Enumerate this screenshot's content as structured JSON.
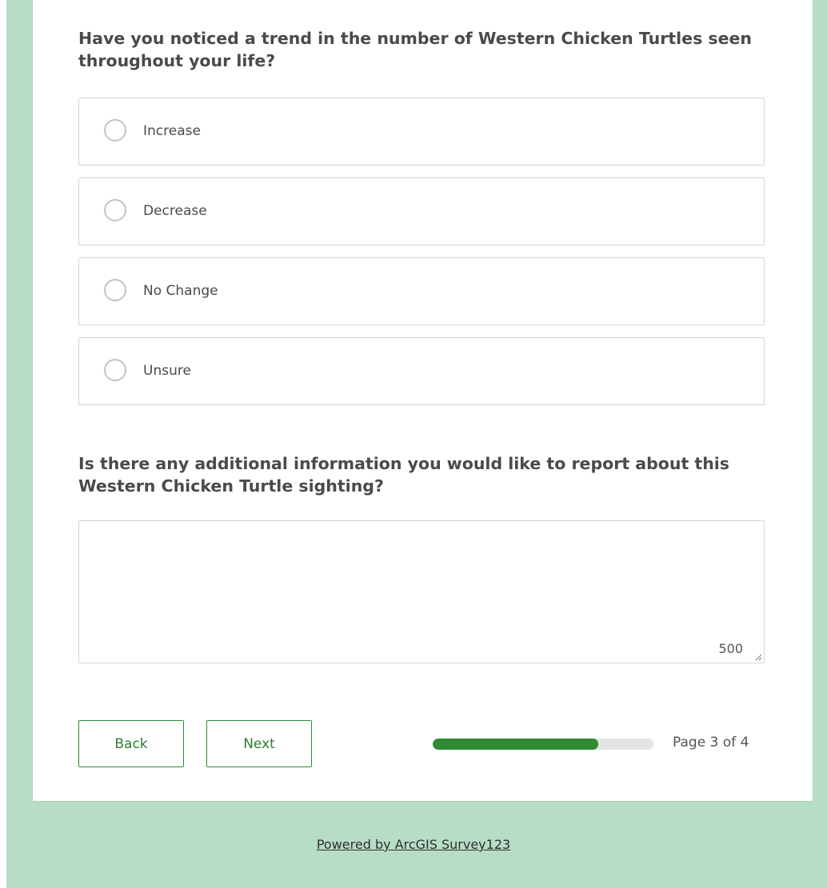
{
  "question1": {
    "title": "Have you noticed a trend in the number of Western Chicken Turtles seen throughout your life?",
    "options": [
      {
        "label": "Increase"
      },
      {
        "label": "Decrease"
      },
      {
        "label": "No Change"
      },
      {
        "label": "Unsure"
      }
    ]
  },
  "question2": {
    "title": "Is there any additional information you would like to report about this Western Chicken Turtle sighting?",
    "value": "",
    "char_remaining": "500"
  },
  "navigation": {
    "back_label": "Back",
    "next_label": "Next",
    "progress_fraction": 0.75,
    "page_text": "Page 3 of 4"
  },
  "footer": {
    "powered_by": "Powered by ArcGIS Survey123"
  },
  "colors": {
    "background": "#b7ddc7",
    "accent": "#2e8b33"
  }
}
